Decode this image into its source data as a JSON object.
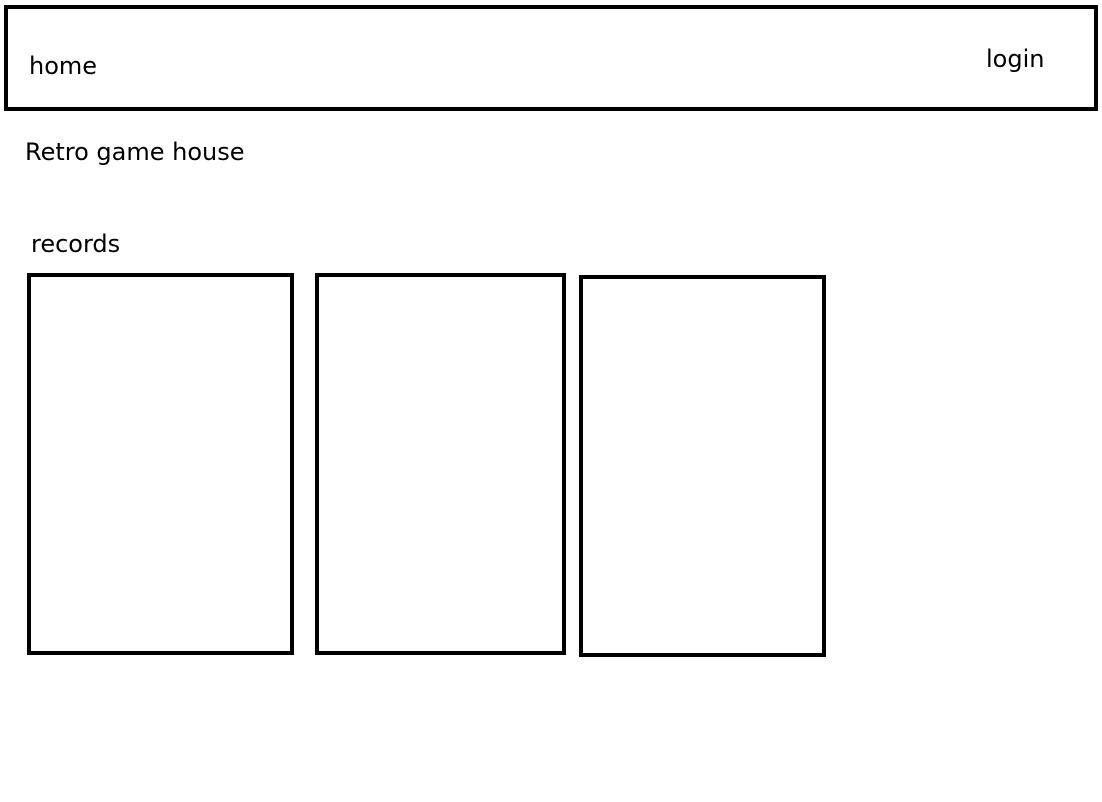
{
  "navbar": {
    "home_label": "home",
    "login_label": "login"
  },
  "site": {
    "title": "Retro game house"
  },
  "records": {
    "heading": "records",
    "cards": [
      {
        "label": ""
      },
      {
        "label": ""
      },
      {
        "label": ""
      }
    ]
  },
  "colors": {
    "border": "#000000",
    "background": "#ffffff",
    "text": "#000000"
  }
}
